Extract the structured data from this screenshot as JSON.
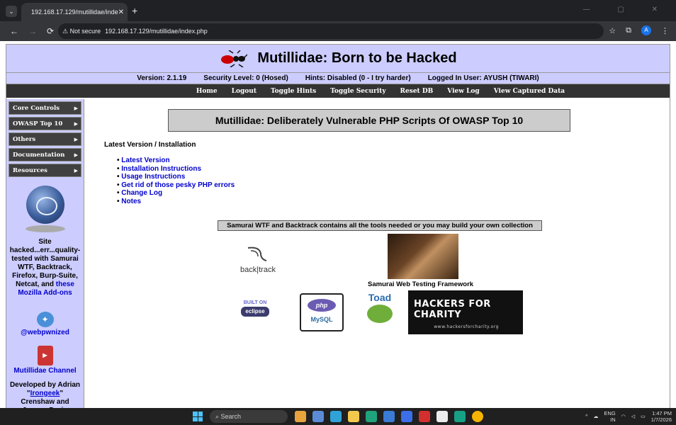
{
  "browser": {
    "tab_title": "192.168.17.129/mutillidae/inde",
    "security_label": "Not secure",
    "url": "192.168.17.129/mutillidae/index.php",
    "profile_initial": "A"
  },
  "site": {
    "title": "Mutillidae: Born to be Hacked",
    "version": "Version: 2.1.19",
    "security_level": "Security Level: 0 (Hosed)",
    "hints": "Hints: Disabled (0 - I try harder)",
    "logged_in": "Logged In User: AYUSH (TIWARI)",
    "menu": [
      "Home",
      "Logout",
      "Toggle Hints",
      "Toggle Security",
      "Reset DB",
      "View Log",
      "View Captured Data"
    ]
  },
  "sidebar": {
    "items": [
      "Core Controls",
      "OWASP Top 10",
      "Others",
      "Documentation",
      "Resources"
    ],
    "site_text": "Site hacked...err...quality-tested with Samurai WTF, Backtrack, Firefox, Burp-Suite, Netcat, and",
    "site_link": "these Mozilla Add-ons",
    "twitter": "@webpwnized",
    "channel": "Mutillidae Channel",
    "dev_prefix": "Developed by Adrian \"",
    "dev_link": "Irongeek",
    "dev_suffix": "\" Crenshaw and Jeremy Druin"
  },
  "main": {
    "banner": "Mutillidae: Deliberately Vulnerable PHP Scripts Of OWASP Top 10",
    "latest_heading": "Latest Version / Installation",
    "links": [
      "Latest Version",
      "Installation Instructions",
      "Usage Instructions",
      "Get rid of those pesky PHP errors",
      "Change Log",
      "Notes"
    ],
    "samurai_bar": "Samurai WTF and Backtrack contains all the tools needed or you may build your own collection",
    "backtrack": "back|track",
    "swf_label": "Samurai Web Testing Framework",
    "eclipse_top": "BUILT ON",
    "eclipse": "eclipse",
    "php": "php",
    "mysql": "MySQL",
    "toad": "Toad",
    "hfc": "HACKERS FOR CHARITY",
    "hfc_url": "www.hackersforcharity.org"
  },
  "taskbar": {
    "search": "Search",
    "lang": "ENG",
    "region": "IN",
    "time": "1:47 PM",
    "date": "1/7/2026"
  }
}
